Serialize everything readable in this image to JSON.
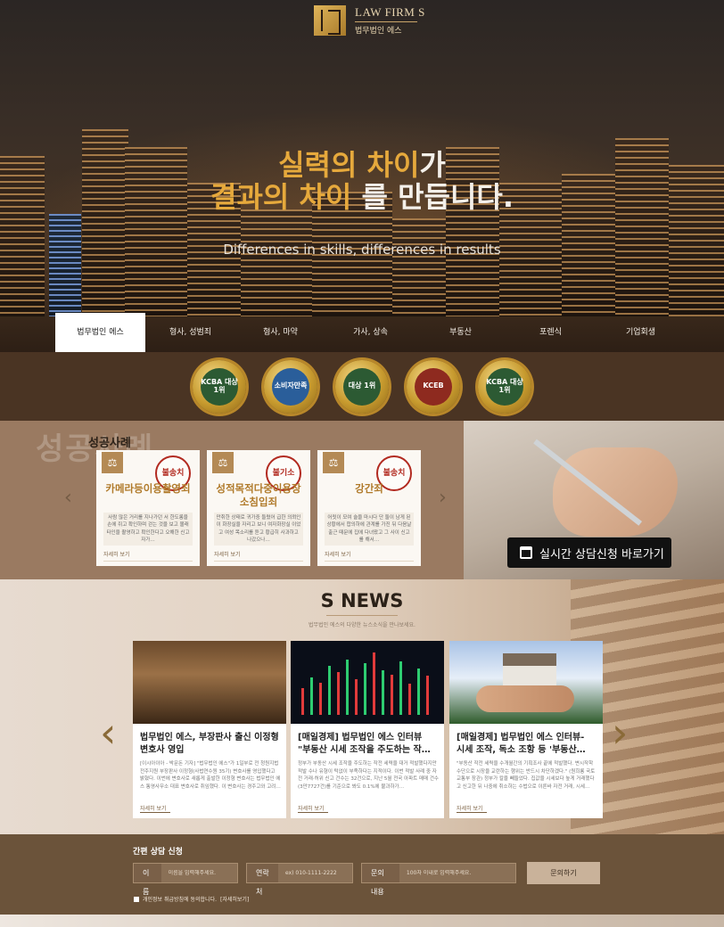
{
  "header": {
    "logo_en": "LAW FIRM S",
    "logo_ko": "법무법인 에스"
  },
  "hero": {
    "line1_gold": "실력의 차이",
    "line1_white": "가",
    "line2_gold": "결과의 차이",
    "line2_white": " 를 만듭니다.",
    "subtitle": "Differences in skills, differences in results"
  },
  "tabs": [
    "법무법인 에스",
    "형사, 성범죄",
    "형사, 마약",
    "가사, 상속",
    "부동산",
    "포렌식",
    "기업회생"
  ],
  "awards": [
    "KCBA 대상 1위",
    "소비자만족",
    "대상 1위",
    "KCEB",
    "KCBA 대상 1위"
  ],
  "success": {
    "bg_text": "성공사례",
    "title": "성공사례",
    "cards": [
      {
        "title": "카메라등이용촬영죄",
        "stamp": "불송치",
        "desc": "사람 많은 거리를 지나가던 서 한도롱을 손에 쥐고 확인하며 걷는 것을 보고 몰래 타인을 촬영하고 확인한다고 오해한 신고자가…",
        "more": "자세히 보기"
      },
      {
        "title": "성적목적다중이용장\n소침입죄",
        "stamp": "불기소",
        "desc": "만취한 상태로 귀가중 들렸어 급한 의뢰인이 화장실을 자리고 보니 여자화장실 이었고 여성 목소리를 듣고 황급히 사과하고 나갔으나…",
        "more": "자세히 보기"
      },
      {
        "title": "강간죄",
        "stamp": "불송치",
        "desc": "어릿이 모여 술을 마시다 단 둘이 남게 된 상황에서 합의하에 관계를 가진 뒤 다음날 출근 때문에 집에 다녀왔고 그 사이 신고를 해서…",
        "more": "자세히 보기"
      }
    ],
    "consult_button": "실시간 상담신청 바로가기"
  },
  "news": {
    "title": "S NEWS",
    "subtitle": "법무법인 에스의 다양한 뉴스소식을 만나보세요.",
    "items": [
      {
        "title": "법무법인 에스, 부장판사 출신 이정형 변호사 영입",
        "desc": "[이시아이아 - 박문돈 기자] \"법무법인 에스\"가 1일부로 전 청원지법 전주지원 부장판사 이정형(사법연수원 35기) 변호사를 영입했다고 밝혔다. 이번에 변호사로 새롭게 출발한 이정형 변호사는 법무법인 에스 통영사무소 대표 변호사로 취임했다. 이 변호사는 경주고와 고려…",
        "more": "자세히 보기"
      },
      {
        "title": "[매일경제] 법무법인 에스 인터뷰 \"부동산 시세 조작을 주도하는 작…",
        "desc": "정부가 부동산 시세 조작을 주도하는 작전 세력을 대거 적발했다지만 적발 수나 유형이 턱없이 부족하다는 지적이다. 이번 적발 사례 중 자전 거래·허위 신고 건수는 32건으로, 지난 5월 전국 아파트 매매 건수 (3만7727건)를 기준으로 봐도 0.1%에 불과하가…",
        "more": "자세히 보기"
      },
      {
        "title": "[매일경제] 법무법인 에스 인터뷰- 시세 조작, 독소 조항 등 '부동산…",
        "desc": "\"부동산 작전 세력을 수개월간의 기획조사 끝에 적발했다. 변시작학 수단으로 시장을 교란하는 행위는 반드시 차단하겠다.\" (원희룡 국토교통부 장관) 정부가 칼을 빼들었다. 집값을 시세보다 높게 거래했다고 신고한 뒤 나중에 취소하는 수법으로 이른바 자전 거래, 시세…",
        "more": "자세히 보기"
      }
    ]
  },
  "form": {
    "title": "간편 상담 신청",
    "name_label": "이름",
    "name_placeholder": "이름을 입력해주세요.",
    "phone_label": "연락처",
    "phone_placeholder": "ex) 010-1111-2222",
    "content_label": "문의내용",
    "content_placeholder": "100자 이내로 입력해주세요.",
    "submit": "문의하기",
    "agree": "개인정보 취급방침에 동의합니다.",
    "agree_link": "[자세히보기]"
  },
  "colors": {
    "gold": "#e6a93c",
    "brown_dark": "#4a3423",
    "form_bg": "#6b533a"
  }
}
